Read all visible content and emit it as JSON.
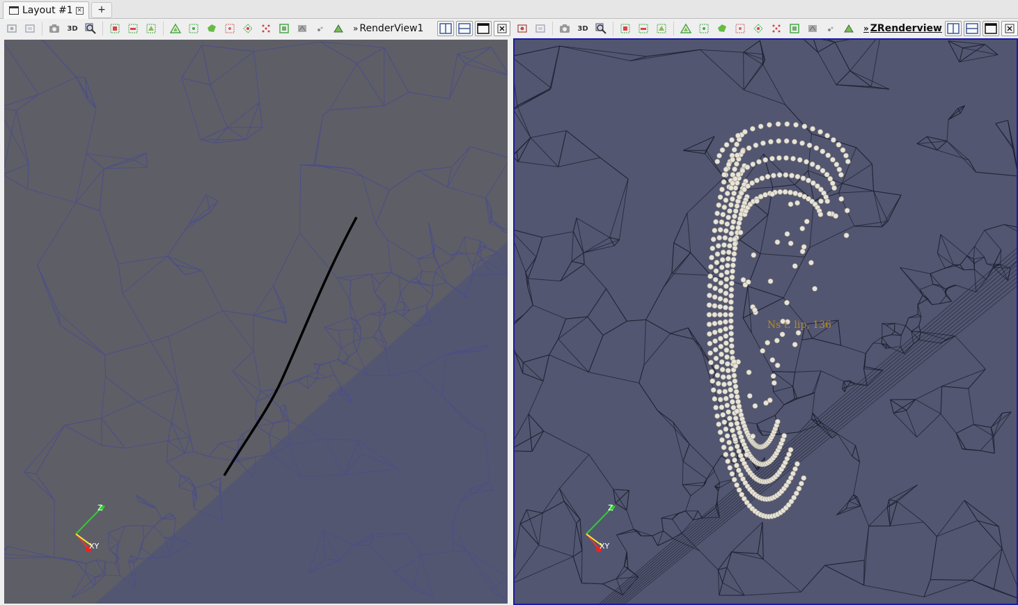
{
  "tabs": [
    {
      "label": "Layout #1",
      "close_icon": "close-icon"
    }
  ],
  "add_tab_label": "+",
  "left_view": {
    "title": "RenderView1",
    "active": false,
    "toolbar_icons": [
      "reset-camera-icon",
      "reset-camera-closest-icon",
      "screenshot-icon",
      "3d-toggle-icon",
      "zoom-to-data-icon",
      "select-cells-on-icon",
      "select-points-on-icon",
      "select-cells-through-icon",
      "select-points-through-icon",
      "select-block-icon",
      "interactive-select-cells-icon",
      "interactive-select-points-icon",
      "select-polygon-cells-icon",
      "select-polygon-points-icon",
      "clear-selection-icon",
      "hover-points-icon",
      "hover-cells-icon"
    ],
    "toggle_3d_label": "3D",
    "background_color": "#5e5e66",
    "lower_region_color": "#535670",
    "mesh_color": "#4c4f86",
    "streamline_color": "#000000",
    "axes": {
      "z": "Z",
      "xy": "XY"
    }
  },
  "right_view": {
    "title": "ZRenderview",
    "active": true,
    "toggle_3d_label": "3D",
    "background_color": "#525670",
    "mesh_color": "#1e2030",
    "particle_color": "#e8e4d8",
    "annotation": "Ns t. lip, 136",
    "annotation_color": "#b88a2a",
    "axes": {
      "z": "Z",
      "xy": "XY"
    }
  },
  "split_buttons": [
    "split-horizontal-icon",
    "split-vertical-icon",
    "maximize-icon",
    "close-view-icon"
  ]
}
